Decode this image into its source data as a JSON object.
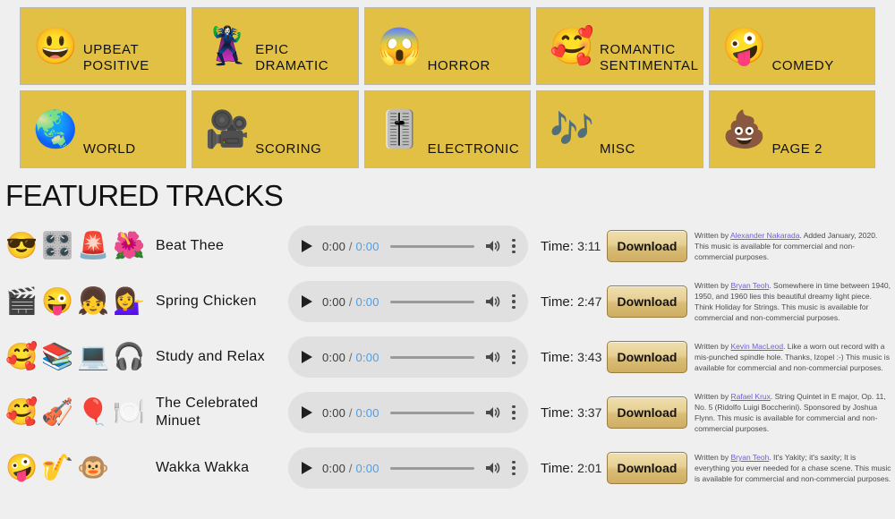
{
  "categories": {
    "rows": [
      [
        {
          "emoji": "😃",
          "icon_name": "grinning-face-emoji",
          "label": "UPBEAT\nPOSITIVE"
        },
        {
          "emoji": "🦹‍♀️",
          "icon_name": "superhero-emoji",
          "label": "EPIC\nDRAMATIC"
        },
        {
          "emoji": "😱",
          "icon_name": "screaming-face-emoji",
          "label": "HORROR"
        },
        {
          "emoji": "🥰",
          "icon_name": "smiling-face-with-hearts-emoji",
          "label": "ROMANTIC\nSENTIMENTAL"
        },
        {
          "emoji": "🤪",
          "icon_name": "zany-face-emoji",
          "label": "COMEDY"
        }
      ],
      [
        {
          "emoji": "🌏",
          "icon_name": "globe-emoji",
          "label": "WORLD"
        },
        {
          "emoji": "🎥",
          "icon_name": "movie-camera-emoji",
          "label": "SCORING"
        },
        {
          "emoji": "🎚️",
          "icon_name": "level-slider-emoji",
          "label": "ELECTRONIC"
        },
        {
          "emoji": "🎶",
          "icon_name": "musical-notes-emoji",
          "label": "MISC"
        },
        {
          "emoji": "💩",
          "icon_name": "pile-of-poo-emoji",
          "label": "PAGE 2"
        }
      ]
    ]
  },
  "featured": {
    "heading": "FEATURED TRACKS",
    "player": {
      "current_time": "0:00",
      "separator": "/",
      "duration": "0:00",
      "play_icon": "play-icon",
      "volume_icon": "volume-icon",
      "menu_icon": "kebab-menu-icon"
    },
    "time_label": "Time:",
    "download_label": "Download",
    "tracks": [
      {
        "emojis": [
          "😎",
          "🎛️",
          "🚨",
          "🌺"
        ],
        "title": "Beat Thee",
        "time": "3:11",
        "desc_before": "Written by ",
        "author": "Alexander Nakarada",
        "desc_after": ". Added January, 2020. This music is available for commercial and non-commercial purposes."
      },
      {
        "emojis": [
          "🎬",
          "😜",
          "👧",
          "💁‍♀️"
        ],
        "title": "Spring Chicken",
        "time": "2:47",
        "desc_before": "Written by ",
        "author": "Bryan Teoh",
        "desc_after": ". Somewhere in time between 1940, 1950, and 1960 lies this beautiful dreamy light piece. Think Holiday for Strings. This music is available for commercial and non-commercial purposes."
      },
      {
        "emojis": [
          "🥰",
          "📚",
          "💻",
          "🎧"
        ],
        "title": "Study and Relax",
        "time": "3:43",
        "desc_before": "Written by ",
        "author": "Kevin MacLeod",
        "desc_after": ". Like a worn out record with a mis-punched spindle hole. Thanks, Izopel :-) This music is available for commercial and non-commercial purposes."
      },
      {
        "emojis": [
          "🥰",
          "🎻",
          "🎈",
          "🍽️"
        ],
        "title": "The Celebrated Minuet",
        "time": "3:37",
        "desc_before": "Written by ",
        "author": "Rafael Krux",
        "desc_after": ". String Quintet in E major, Op. 11, No. 5 (Ridolfo Luigi Boccherini). Sponsored by Joshua Flynn. This music is available for commercial and non-commercial purposes."
      },
      {
        "emojis": [
          "🤪",
          "🎷",
          "🐵"
        ],
        "title": "Wakka Wakka",
        "time": "2:01",
        "desc_before": "Written by ",
        "author": "Bryan Teoh",
        "desc_after": ". It's Yakity; it's saxity; It is everything you ever needed for a chase scene. This music is available for commercial and non-commercial purposes."
      }
    ]
  },
  "colors": {
    "tile_yellow": "#e2c044",
    "page_bg": "#efefef",
    "player_bg": "#e0e0e0",
    "download_gold": "#ddc382",
    "link": "#6b5fd6",
    "duration_blue": "#4a9eed"
  }
}
